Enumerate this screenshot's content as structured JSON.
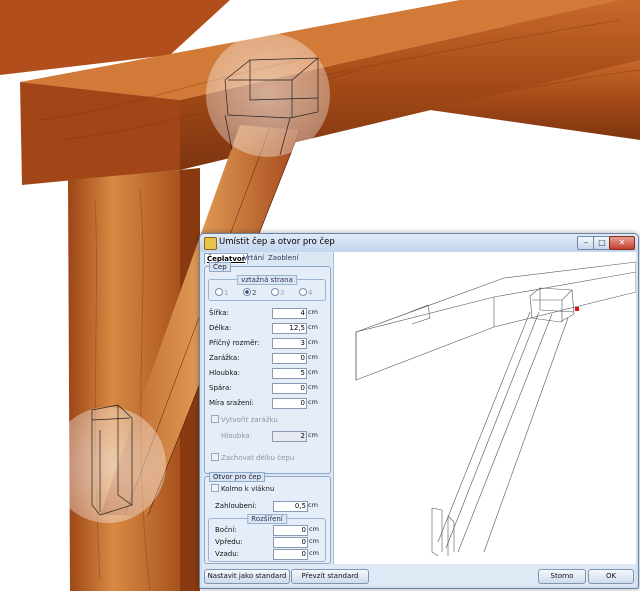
{
  "dialog": {
    "title": "Umístit čep a otvor pro čep",
    "window_controls": {
      "minimize": "–",
      "maximize": "□",
      "close": "✕"
    },
    "tabs": [
      "Čeplatvor",
      "Vrtání",
      "Zaoblení"
    ],
    "cep": {
      "group_title": "Čep",
      "strana_title": "vztažná strana",
      "strana_options": [
        "1",
        "2",
        "3",
        "4"
      ],
      "strana_selected": "2",
      "fields": [
        {
          "label": "Šířka:",
          "value": "4",
          "unit": "cm"
        },
        {
          "label": "Délka:",
          "value": "12,5",
          "unit": "cm"
        },
        {
          "label": "Příčný rozměr:",
          "value": "3",
          "unit": "cm"
        },
        {
          "label": "Zarážka:",
          "value": "0",
          "unit": "cm"
        },
        {
          "label": "Hloubka:",
          "value": "5",
          "unit": "cm"
        },
        {
          "label": "Spára:",
          "value": "0",
          "unit": "cm"
        },
        {
          "label": "Míra sražení:",
          "value": "0",
          "unit": "cm"
        }
      ],
      "vytvorit_zarazku": "Vytvořit zarážku",
      "hloubka_label": "Hloubka:",
      "hloubka_value": "2",
      "hloubka_unit": "cm",
      "zachovat": "Zachovat délku čepu"
    },
    "otvor": {
      "group_title": "Otvor pro čep",
      "kolmo": "Kolmo k vláknu",
      "zahloubeni_label": "Zahloubení:",
      "zahloubeni_value": "0,5",
      "zahloubeni_unit": "cm",
      "rozsireni_title": "Rozšíření",
      "rozsireni": [
        {
          "label": "Boční:",
          "value": "0",
          "unit": "cm"
        },
        {
          "label": "Vpředu:",
          "value": "0",
          "unit": "cm"
        },
        {
          "label": "Vzadu:",
          "value": "0",
          "unit": "cm"
        }
      ]
    },
    "buttons": {
      "standard": "Nastavit jako standard",
      "prevzit": "Převzít standard",
      "storno": "Storno",
      "ok": "OK"
    }
  },
  "colors": {
    "wood_light": "#d9823b",
    "wood_dark": "#8a3a10",
    "wood_mid": "#b55a22",
    "highlight": "#f3e6dc"
  }
}
